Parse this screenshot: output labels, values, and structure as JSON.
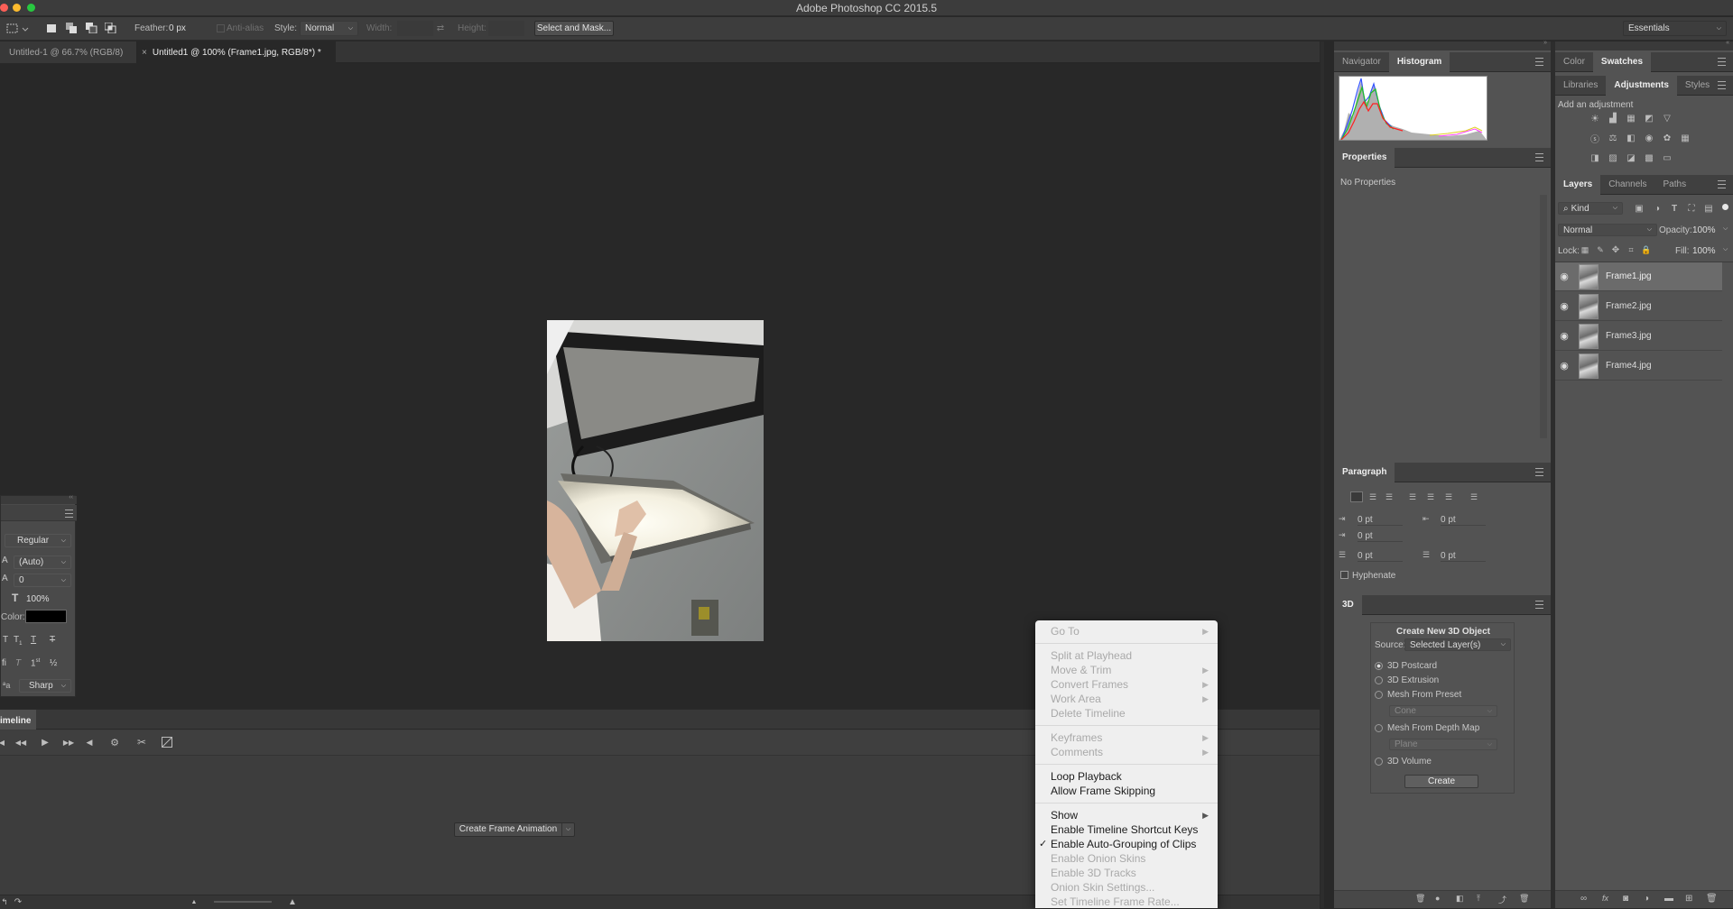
{
  "app": {
    "title": "Adobe Photoshop CC 2015.5"
  },
  "options_bar": {
    "feather_label": "Feather:",
    "feather_value": "0 px",
    "anti_alias_label": "Anti-alias",
    "style_label": "Style:",
    "style_value": "Normal",
    "width_label": "Width:",
    "height_label": "Height:",
    "select_mask_button": "Select and Mask...",
    "workspace_value": "Essentials"
  },
  "doc_tabs": [
    {
      "label": "Untitled-1 @ 66.7% (RGB/8)"
    },
    {
      "label": "Untitled1 @ 100% (Frame1.jpg, RGB/8*) *"
    }
  ],
  "character_panel": {
    "style_value": "Regular",
    "leading_value": "(Auto)",
    "tracking_value": "0",
    "scale_value": "100%",
    "color_label": "Color:",
    "antialias_value": "Sharp",
    "color_swatch": "#000000"
  },
  "timeline": {
    "tab_label": "imeline",
    "create_button": "Create Frame Animation"
  },
  "context_menu": {
    "items": [
      {
        "label": "Go To",
        "disabled": true,
        "submenu": true
      },
      {
        "sep": true
      },
      {
        "label": "Split at Playhead",
        "disabled": true
      },
      {
        "label": "Move & Trim",
        "disabled": true,
        "submenu": true
      },
      {
        "label": "Convert Frames",
        "disabled": true,
        "submenu": true
      },
      {
        "label": "Work Area",
        "disabled": true,
        "submenu": true
      },
      {
        "label": "Delete Timeline",
        "disabled": true
      },
      {
        "sep": true
      },
      {
        "label": "Keyframes",
        "disabled": true,
        "submenu": true
      },
      {
        "label": "Comments",
        "disabled": true,
        "submenu": true
      },
      {
        "sep": true
      },
      {
        "label": "Loop Playback",
        "disabled": false
      },
      {
        "label": "Allow Frame Skipping",
        "disabled": false
      },
      {
        "sep": true
      },
      {
        "label": "Show",
        "disabled": false,
        "submenu": true
      },
      {
        "label": "Enable Timeline Shortcut Keys",
        "disabled": false
      },
      {
        "label": "Enable Auto-Grouping of Clips",
        "disabled": false,
        "checked": true
      },
      {
        "label": "Enable Onion Skins",
        "disabled": true
      },
      {
        "label": "Enable 3D Tracks",
        "disabled": true
      },
      {
        "label": "Onion Skin Settings...",
        "disabled": true
      },
      {
        "label": "Set Timeline Frame Rate...",
        "disabled": true
      }
    ]
  },
  "navigator": {
    "tabs": [
      "Navigator",
      "Histogram"
    ]
  },
  "properties": {
    "tab": "Properties",
    "empty_text": "No Properties"
  },
  "paragraph": {
    "tab": "Paragraph",
    "indent_left": "0 pt",
    "indent_right": "0 pt",
    "first_line": "0 pt",
    "space_before": "0 pt",
    "space_after": "0 pt",
    "hyphenate_label": "Hyphenate"
  },
  "threed": {
    "tab": "3D",
    "title": "Create New 3D Object",
    "source_label": "Source:",
    "source_value": "Selected Layer(s)",
    "options": [
      {
        "label": "3D Postcard",
        "selected": true
      },
      {
        "label": "3D Extrusion",
        "selected": false
      },
      {
        "label": "Mesh From Preset",
        "selected": false
      }
    ],
    "preset_value": "Cone",
    "depth_option": "Mesh From Depth Map",
    "depth_value": "Plane",
    "volume_option": "3D Volume",
    "create_button": "Create"
  },
  "right_panels": {
    "color_tabs": [
      "Color",
      "Swatches"
    ],
    "adj_tabs": [
      "Libraries",
      "Adjustments",
      "Styles"
    ],
    "add_adjustment": "Add an adjustment",
    "layers_tabs": [
      "Layers",
      "Channels",
      "Paths"
    ],
    "kind_value": "Kind",
    "blend_value": "Normal",
    "opacity_label": "Opacity:",
    "opacity_value": "100%",
    "lock_label": "Lock:",
    "fill_label": "Fill:",
    "fill_value": "100%"
  },
  "layers": [
    {
      "name": "Frame1.jpg",
      "selected": true
    },
    {
      "name": "Frame2.jpg",
      "selected": false
    },
    {
      "name": "Frame3.jpg",
      "selected": false
    },
    {
      "name": "Frame4.jpg",
      "selected": false
    }
  ]
}
